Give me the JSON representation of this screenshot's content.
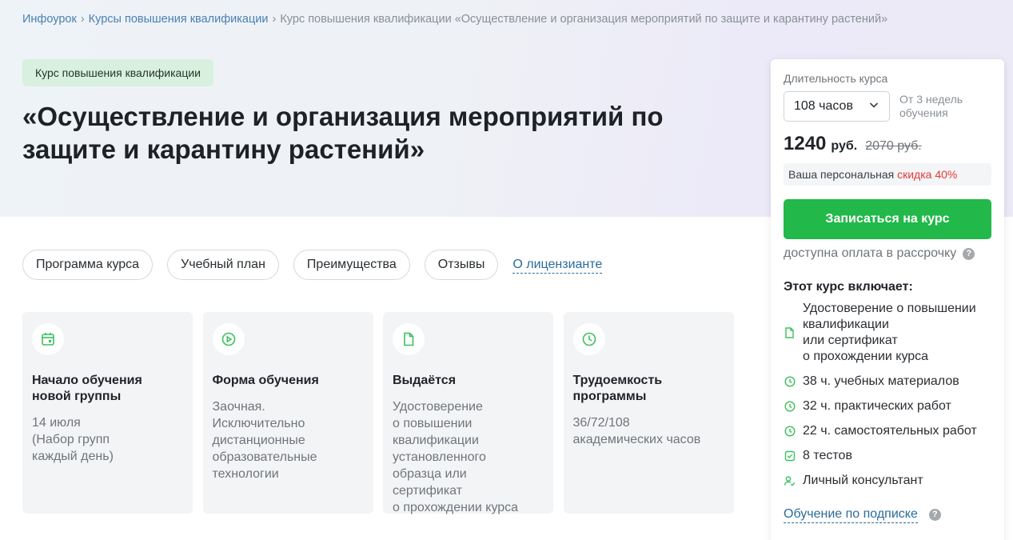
{
  "breadcrumb": {
    "items": [
      "Инфоурок",
      "Курсы повышения квалификации"
    ],
    "current": "Курс повышения квалификации «Осуществление и организация мероприятий по защите и карантину растений»",
    "separator": "›"
  },
  "badge": "Курс повышения квалификации",
  "title": "«Осуществление и организация мероприятий по защите и карантину растений»",
  "tabs": [
    "Программа курса",
    "Учебный план",
    "Преимущества",
    "Отзывы"
  ],
  "tab_link": "О лицензианте",
  "cards": [
    {
      "icon": "calendar-icon",
      "title": "Начало обучения новой группы",
      "text": "14 июля\n(Набор групп\nкаждый день)"
    },
    {
      "icon": "play-icon",
      "title": "Форма обучения",
      "text": "Заочная.\nИсключительно\nдистанционные\nобразовательные\nтехнологии"
    },
    {
      "icon": "document-icon",
      "title": "Выдаётся",
      "text": "Удостоверение\nо повышении\nквалификации\nустановленного\nобразца или\nсертификат\nо прохождении курса"
    },
    {
      "icon": "clock-icon",
      "title": "Трудоемкость программы",
      "text": "36/72/108\nакадемических часов"
    }
  ],
  "panel": {
    "duration_label": "Длительность курса",
    "duration_value": "108 часов",
    "duration_note": "От 3 недель обучения",
    "price": "1240",
    "currency": "руб.",
    "old_price": "2070 руб.",
    "discount_text": "Ваша персональная ",
    "discount_value": "скидка 40%",
    "enroll_label": "Записаться на курс",
    "installment": "доступна оплата в рассрочку",
    "includes_title": "Этот курс включает:",
    "includes": [
      {
        "icon": "document-icon",
        "text": "Удостоверение о повышении\nквалификации\nили сертификат\nо прохождении курса"
      },
      {
        "icon": "clock-icon",
        "text": "38 ч. учебных материалов"
      },
      {
        "icon": "clock-icon",
        "text": "32 ч. практических работ"
      },
      {
        "icon": "clock-icon",
        "text": "22 ч. самостоятельных работ"
      },
      {
        "icon": "checkbox-icon",
        "text": "8 тестов"
      },
      {
        "icon": "user-check-icon",
        "text": "Личный консультант"
      }
    ],
    "subscription_link": "Обучение по подписке"
  },
  "colors": {
    "accent_green": "#22b84a",
    "link_blue": "#2a6b9c",
    "discount_red": "#e53935",
    "badge_bg": "#d8f1de"
  }
}
